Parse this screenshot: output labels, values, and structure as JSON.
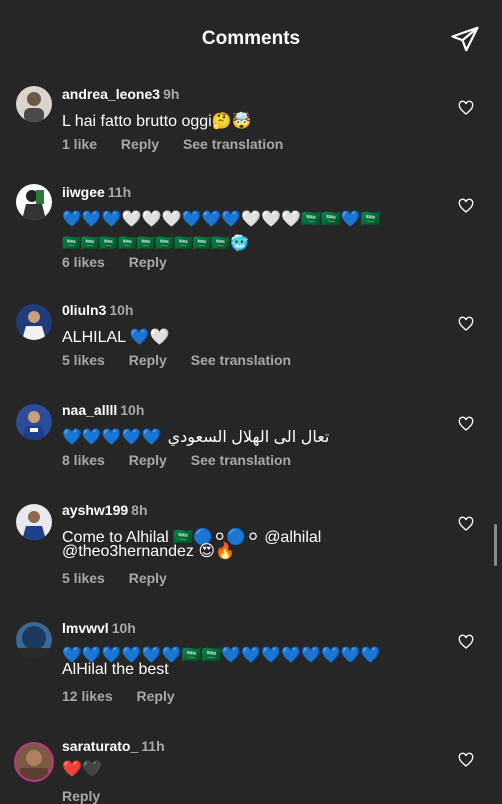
{
  "header": {
    "title": "Comments"
  },
  "comments": [
    {
      "user": "andrea_leone3",
      "time": "9h",
      "text": "L hai fatto brutto oggi🤔🤯",
      "likes": "1 like",
      "reply": "Reply",
      "translate": "See translation"
    },
    {
      "user": "iiwgee",
      "time": "11h",
      "text1": "💙💙💙🤍🤍🤍💙💙💙🤍🤍🤍🇸🇦🇸🇦💙🇸🇦",
      "text2": "🇸🇦🇸🇦🇸🇦🇸🇦🇸🇦🇸🇦🇸🇦🇸🇦🇸🇦🥶",
      "likes": "6 likes",
      "reply": "Reply"
    },
    {
      "user": "0liuln3",
      "time": "10h",
      "text": "ALHILAL 💙🤍",
      "likes": "5 likes",
      "reply": "Reply",
      "translate": "See translation"
    },
    {
      "user": "naa_allll",
      "time": "10h",
      "emoji": "💙💙💙💙💙",
      "arabic": "تعال الى الهلال السعودي",
      "likes": "8 likes",
      "reply": "Reply",
      "translate": "See translation"
    },
    {
      "user": "ayshw199",
      "time": "8h",
      "text1": "Come to Alhilal 🇸🇦🔵⚪🔵⚪ @alhilal",
      "text2": "@theo3hernandez 😍🔥",
      "likes": "5 likes",
      "reply": "Reply"
    },
    {
      "user": "lmvwvl",
      "time": "10h",
      "text1": "💙💙💙💙💙💙🇸🇦🇸🇦💙💙💙💙💙💙💙💙",
      "text2": "AlHilal the best",
      "likes": "12 likes",
      "reply": "Reply"
    },
    {
      "user": "saraturato_",
      "time": "11h",
      "text": "❤️🖤",
      "reply": "Reply"
    }
  ],
  "colors": {
    "background": "#262626",
    "secondary_text": "#a8a8a8",
    "accent_ring": "#c13584"
  },
  "icons": {
    "send": "paper-plane-icon",
    "like": "heart-outline-icon"
  }
}
